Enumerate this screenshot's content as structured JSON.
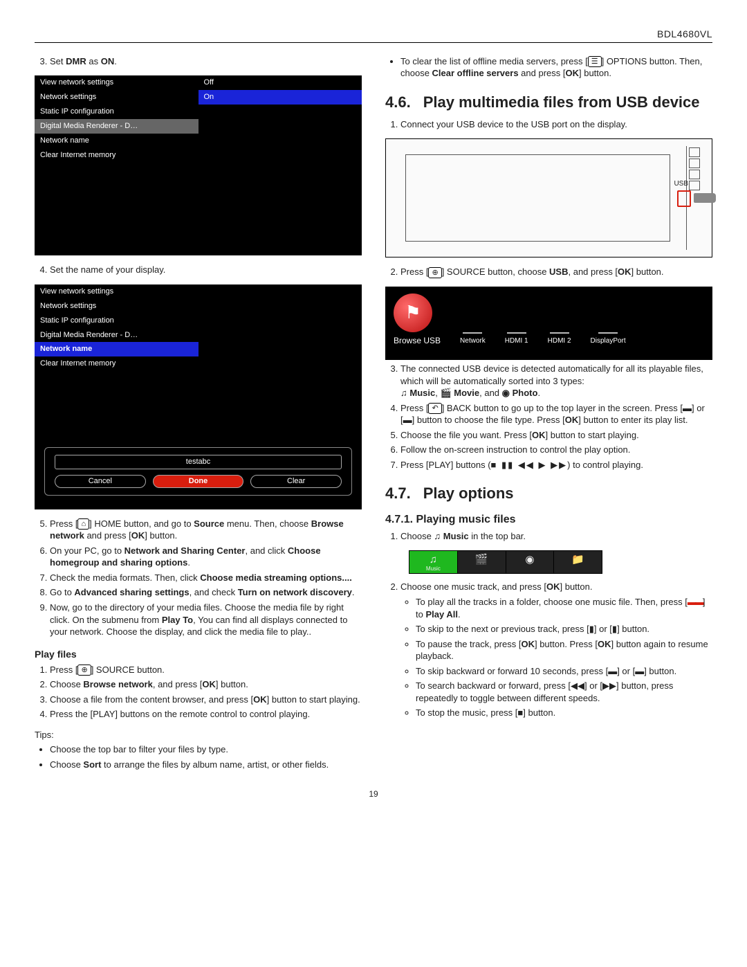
{
  "header": {
    "model": "BDL4680VL"
  },
  "page_number": "19",
  "left": {
    "step3": {
      "prefix": "Set ",
      "bold1": "DMR",
      "mid": " as ",
      "bold2": "ON",
      "suffix": "."
    },
    "screen1": {
      "menu": [
        "View network settings",
        "Network settings",
        "Static IP configuration",
        "Digital Media Renderer - D…",
        "Network name",
        "Clear Internet memory"
      ],
      "menu_sel_index": 3,
      "right_col": {
        "off": "Off",
        "on": "On"
      }
    },
    "step4": "Set the name of your display.",
    "screen2": {
      "menu": [
        "View network settings",
        "Network settings",
        "Static IP configuration",
        "Digital Media Renderer - D…",
        "Network name",
        "Clear Internet memory"
      ],
      "menu_sel_index": 4,
      "input_value": "testabc",
      "buttons": {
        "cancel": "Cancel",
        "done": "Done",
        "clear": "Clear"
      }
    },
    "step5": {
      "t": "Press  [",
      "home": "⌂",
      "t2": "] HOME button, and go to ",
      "bold1": "Source",
      "t3": " menu. Then, choose ",
      "bold2": "Browse network",
      "t4": " and press [",
      "ok": "OK",
      "t5": "] button."
    },
    "step6": {
      "t": "On your PC, go to ",
      "bold1": "Network and Sharing Center",
      "t2": ", and click ",
      "bold2": "Choose homegroup and sharing options",
      "t3": "."
    },
    "step7": {
      "t": "Check the media formats. Then, click ",
      "bold1": "Choose media streaming options....",
      "t2": ""
    },
    "step8": {
      "t": "Go to ",
      "bold1": "Advanced sharing settings",
      "t2": ", and check ",
      "bold2": "Turn on network discovery",
      "t3": "."
    },
    "step9": {
      "t": "Now, go to the directory of your media files. Choose the media file by right click. On the submenu from ",
      "bold1": "Play To",
      "t2": ", You can find all displays connected to your network. Choose the display, and click the media file to play.."
    },
    "playfiles": {
      "heading": "Play files",
      "s1": {
        "t": "Press [",
        "src": "⊕",
        "t2": "] SOURCE button."
      },
      "s2": {
        "t": "Choose ",
        "bold1": "Browse network",
        "t2": ", and press [",
        "ok": "OK",
        "t3": "] button."
      },
      "s3": {
        "t": "Choose a file from the content browser, and press [",
        "ok": "OK",
        "t2": "] button to start playing."
      },
      "s4": "Press the [PLAY] buttons on the remote control to control playing.",
      "tips_label": "Tips:",
      "tip1": "Choose the top bar to filter your files by type.",
      "tip2": {
        "t": "Choose ",
        "bold1": "Sort",
        "t2": " to arrange the files by album name, artist, or other fields."
      }
    },
    "tip3": {
      "t": "To clear the list of offline media servers, press [",
      "opt": "☰",
      "t2": "] OPTIONS button. Then, choose ",
      "bold1": "Clear offline servers",
      "t3": " and press [",
      "ok": "OK",
      "t4": "] button."
    }
  },
  "right": {
    "sec46": {
      "num": "4.6.",
      "title": "Play multimedia files from USB device"
    },
    "s46_1": "Connect your USB device to the USB port on the display.",
    "usb_label": "USB",
    "s46_2": {
      "t": "Press [",
      "src": "⊕",
      "t2": "] SOURCE button, choose ",
      "bold1": "USB",
      "t3": ", and press [",
      "ok": "OK",
      "t4": "] button."
    },
    "source_bar": {
      "browse": "Browse USB",
      "items": [
        "Network",
        "HDMI 1",
        "HDMI 2",
        "DisplayPort"
      ]
    },
    "s46_3": {
      "t": "The connected USB device is detected automatically for all its playable files, which will be automatically sorted into 3 types: ",
      "music_icon": "♫",
      "music": "Music",
      "movie_icon": "🎬",
      "movie": "Movie",
      "and": ", and ",
      "photo_icon": "◉",
      "photo": "Photo",
      "dot": "."
    },
    "s46_4": {
      "t": "Press [",
      "back": "↶",
      "t2": "] BACK button to go up to the top layer in the screen. Press [",
      "left": "▬",
      "or": "] or [",
      "right": "▬",
      "t3": "] button to choose the file type. Press [",
      "ok": "OK",
      "t4": "] button to enter its play list."
    },
    "s46_5": {
      "t": "Choose the file you want. Press [",
      "ok": "OK",
      "t2": "] button to start playing."
    },
    "s46_6": "Follow the on-screen instruction to control the play option.",
    "s46_7": {
      "t": "Press  [PLAY] buttons (",
      "syms": "■  ▮▮  ◀◀  ▶  ▶▶",
      "t2": ") to control playing."
    },
    "sec47": {
      "num": "4.7.",
      "title": "Play options"
    },
    "sec471": {
      "title": "4.7.1. Playing music files"
    },
    "s471_1": {
      "t": "Choose ",
      "icon": "♫",
      "bold1": "Music",
      "t2": " in the top bar."
    },
    "topbar_icons": {
      "music": "♫",
      "music_label": "Music",
      "movie": "🎬",
      "photo": "◉",
      "folder": "📁"
    },
    "s471_2": {
      "t": "Choose one music track, and press [",
      "ok": "OK",
      "t2": "] button."
    },
    "s471_2a": {
      "t": "To play all the tracks in a folder, choose one music file. Then, press [",
      "red": "▬▬",
      "t2": "] to ",
      "bold1": "Play All",
      "t3": "."
    },
    "s471_2b": {
      "t": "To skip to the next or previous track, press [",
      "up": "▮",
      "or": "] or [",
      "down": "▮",
      "t2": "] button."
    },
    "s471_2c": {
      "t": "To pause the track, press [",
      "ok": "OK",
      "t2": "] button. Press [",
      "ok2": "OK",
      "t3": "] button again to resume playback."
    },
    "s471_2d": {
      "t": "To skip backward or forward 10 seconds, press [",
      "left": "▬",
      "or": "] or [",
      "right": "▬",
      "t2": "] button."
    },
    "s471_2e": {
      "t": "To search backward or forward, press [",
      "rew": "◀◀",
      "or": "] or [",
      "fwd": "▶▶",
      "t2": "] button, press repeatedly to toggle between different speeds."
    },
    "s471_2f": {
      "t": "To stop the music, press [",
      "stop": "■",
      "t2": "] button."
    }
  }
}
